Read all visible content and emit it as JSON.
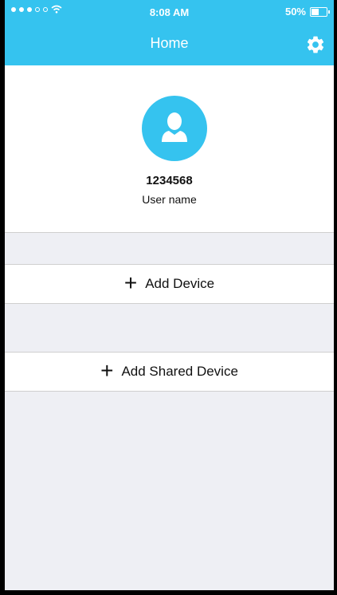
{
  "status_bar": {
    "time": "8:08 AM",
    "battery": "50%"
  },
  "header": {
    "title": "Home"
  },
  "profile": {
    "user_id": "1234568",
    "user_name": "User name"
  },
  "actions": [
    {
      "label": "Add Device"
    },
    {
      "label": "Add Shared Device"
    }
  ],
  "colors": {
    "accent": "#35c3ef",
    "background": "#eeeff4"
  }
}
